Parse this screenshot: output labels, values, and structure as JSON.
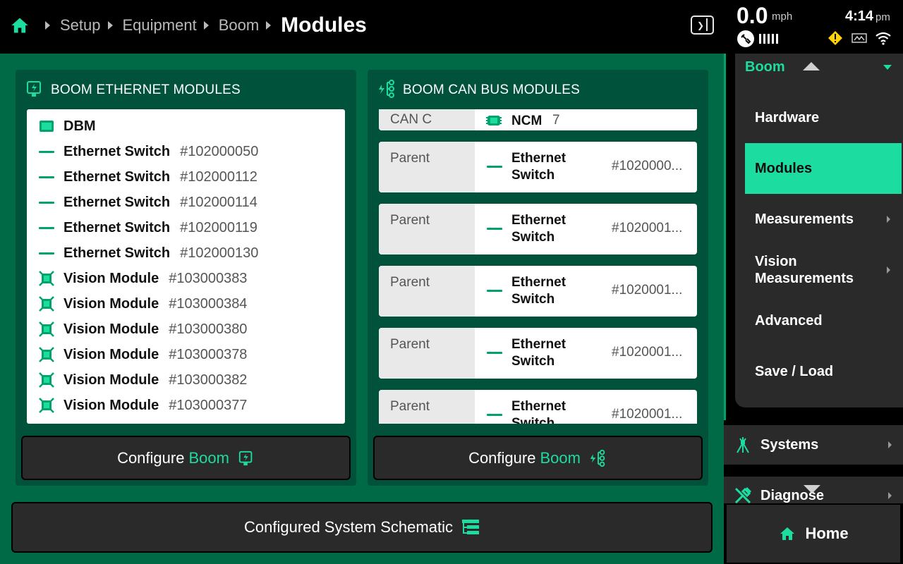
{
  "breadcrumb": {
    "items": [
      "Setup",
      "Equipment",
      "Boom"
    ],
    "current": "Modules"
  },
  "status": {
    "speed": "0.0",
    "speed_unit": "mph",
    "time": "4:14",
    "ampm": "pm"
  },
  "ethernet_card": {
    "title": "BOOM ETHERNET MODULES",
    "rows": [
      {
        "icon": "dbm-icon",
        "name": "DBM",
        "serial": ""
      },
      {
        "icon": "switch-dash-icon",
        "name": "Ethernet Switch",
        "serial": "#102000050"
      },
      {
        "icon": "switch-dash-icon",
        "name": "Ethernet Switch",
        "serial": "#102000112"
      },
      {
        "icon": "switch-dash-icon",
        "name": "Ethernet Switch",
        "serial": "#102000114"
      },
      {
        "icon": "switch-dash-icon",
        "name": "Ethernet Switch",
        "serial": "#102000119"
      },
      {
        "icon": "switch-dash-icon",
        "name": "Ethernet Switch",
        "serial": "#102000130"
      },
      {
        "icon": "vision-module-icon",
        "name": "Vision Module",
        "serial": "#103000383"
      },
      {
        "icon": "vision-module-icon",
        "name": "Vision Module",
        "serial": "#103000384"
      },
      {
        "icon": "vision-module-icon",
        "name": "Vision Module",
        "serial": "#103000380"
      },
      {
        "icon": "vision-module-icon",
        "name": "Vision Module",
        "serial": "#103000378"
      },
      {
        "icon": "vision-module-icon",
        "name": "Vision Module",
        "serial": "#103000382"
      },
      {
        "icon": "vision-module-icon",
        "name": "Vision Module",
        "serial": "#103000377"
      }
    ],
    "button": {
      "label": "Configure",
      "accent": "Boom"
    }
  },
  "can_card": {
    "title": "BOOM CAN BUS MODULES",
    "partial_row": {
      "label": "CAN C",
      "name": "NCM",
      "serial": "7"
    },
    "rows": [
      {
        "label": "Parent",
        "name": "Ethernet Switch",
        "serial": "#1020000..."
      },
      {
        "label": "Parent",
        "name": "Ethernet Switch",
        "serial": "#1020001..."
      },
      {
        "label": "Parent",
        "name": "Ethernet Switch",
        "serial": "#1020001..."
      },
      {
        "label": "Parent",
        "name": "Ethernet Switch",
        "serial": "#1020001..."
      },
      {
        "label": "Parent",
        "name": "Ethernet Switch",
        "serial": "#1020001..."
      }
    ],
    "button": {
      "label": "Configure",
      "accent": "Boom"
    }
  },
  "schematic_button": "Configured System Schematic",
  "sidebar": {
    "section": "Boom",
    "items": [
      "Hardware",
      "Modules",
      "Measurements",
      "Vision Measurements",
      "Advanced",
      "Save / Load"
    ],
    "active": "Modules",
    "systems": "Systems",
    "diagnose": "Diagnose",
    "home": "Home"
  },
  "colors": {
    "accent": "#1ddc9f",
    "main_bg": "#006a47",
    "card_bg": "#00533a",
    "button_bg": "#2a2a2a"
  }
}
